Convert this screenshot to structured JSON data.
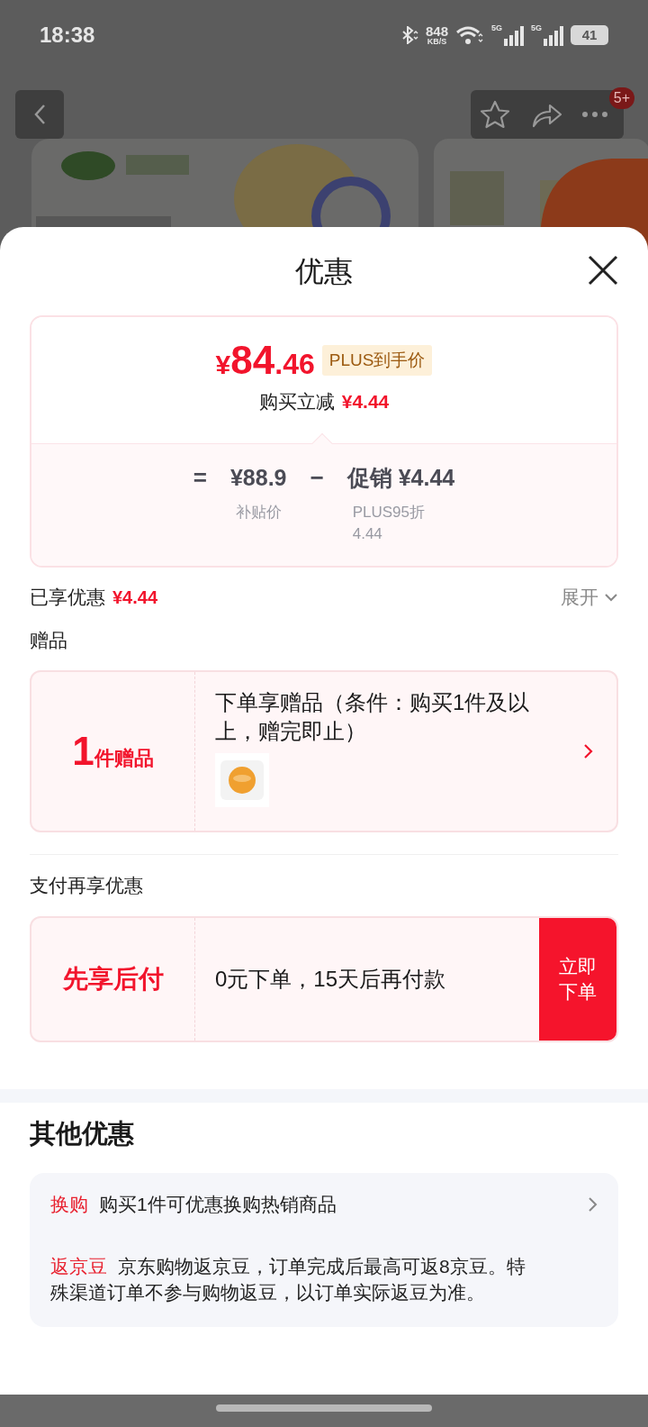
{
  "status_bar": {
    "time": "18:38",
    "net_speed": "848",
    "net_unit": "KB/S",
    "signals": [
      "5G",
      "5G"
    ],
    "battery": "41"
  },
  "header": {
    "badge": "5+"
  },
  "sheet": {
    "title": "优惠",
    "price_card": {
      "currency": "¥",
      "integer": "84",
      "decimal": ".46",
      "tag": "PLUS到手价",
      "reduce_label": "购买立减",
      "reduce_amount": "¥4.44",
      "formula": [
        {
          "kind": "op",
          "text": "="
        },
        {
          "kind": "term",
          "value": "¥88.9",
          "caption": [
            "补贴价"
          ]
        },
        {
          "kind": "op",
          "text": "−"
        },
        {
          "kind": "term",
          "value": "促销 ¥4.44",
          "caption": [
            "PLUS95折",
            "4.44"
          ]
        }
      ]
    },
    "enjoyed": {
      "label": "已享优惠",
      "amount": "¥4.44",
      "toggle": "展开",
      "expanded": false
    },
    "gifts": {
      "title": "赠品",
      "count": "1",
      "unit": "件赠品",
      "desc": "下单享赠品（条件：购买1件及以上，赠完即止）"
    },
    "payment": {
      "title": "支付再享优惠",
      "name": "先享后付",
      "desc": "0元下单，15天后再付款",
      "button": "立即下单"
    },
    "other": {
      "title": "其他优惠",
      "items": [
        {
          "tag": "换购",
          "text": "购买1件可优惠换购热销商品",
          "has_arrow": true
        },
        {
          "tag": "返京豆",
          "text": "京东购物返京豆，订单完成后最高可返8京豆。特殊渠道订单不参与购物返豆，以订单实际返豆为准。",
          "has_arrow": false
        }
      ]
    }
  }
}
